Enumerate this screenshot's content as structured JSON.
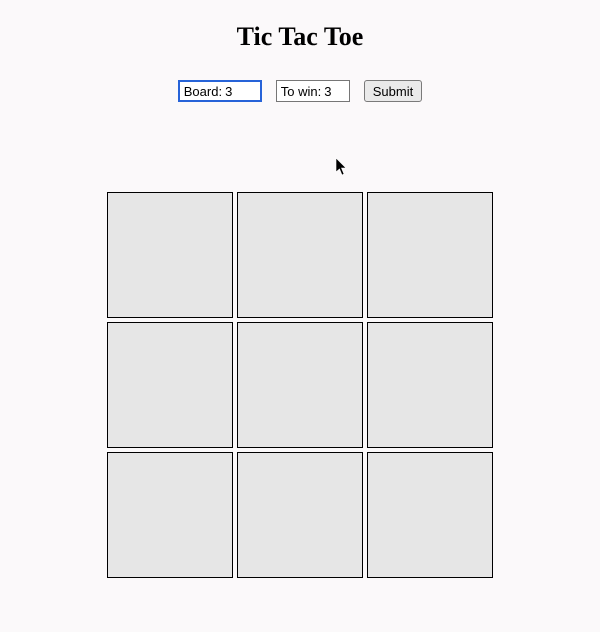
{
  "title": "Tic Tac Toe",
  "controls": {
    "board_label": "Board:",
    "board_value": "3",
    "towin_label": "To win:",
    "towin_value": "3",
    "submit_label": "Submit"
  },
  "board": {
    "size": 3,
    "cells": [
      "",
      "",
      "",
      "",
      "",
      "",
      "",
      "",
      ""
    ]
  }
}
